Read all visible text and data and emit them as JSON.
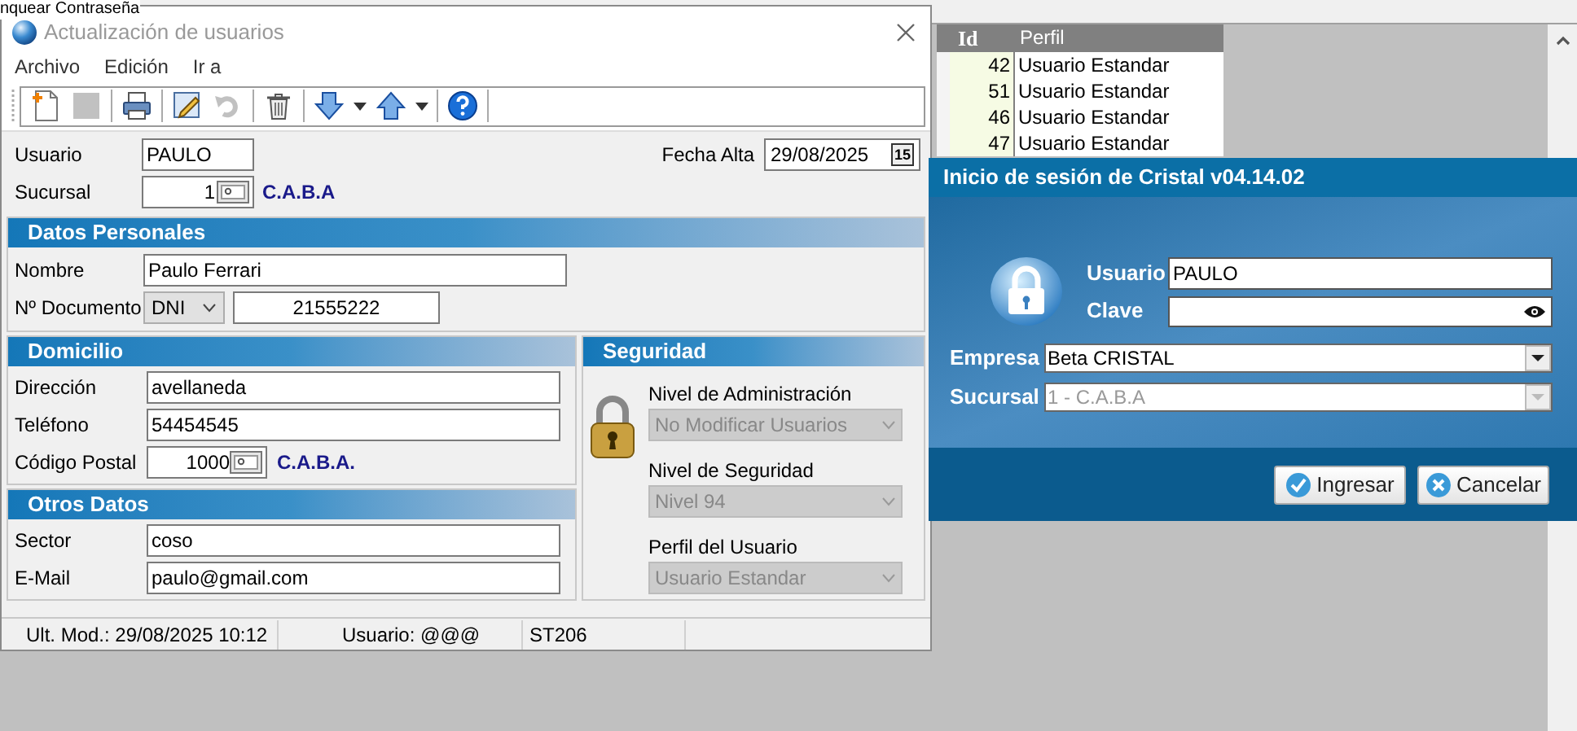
{
  "background_app": {
    "menu_item": "nquear Contraseña",
    "grid": {
      "columns": [
        "Id",
        "Perfil"
      ],
      "rows": [
        {
          "id": "42",
          "perfil": "Usuario Estandar"
        },
        {
          "id": "51",
          "perfil": "Usuario Estandar"
        },
        {
          "id": "46",
          "perfil": "Usuario Estandar"
        },
        {
          "id": "47",
          "perfil": "Usuario Estandar"
        }
      ]
    }
  },
  "edit_window": {
    "title": "Actualización de usuarios",
    "menu": [
      "Archivo",
      "Edición",
      "Ir a"
    ],
    "toolbar": [
      {
        "kind": "new",
        "disabled": false
      },
      {
        "kind": "save",
        "disabled": true
      },
      {
        "kind": "print",
        "disabled": false
      },
      {
        "kind": "edit",
        "disabled": false
      },
      {
        "kind": "undo",
        "disabled": true
      },
      {
        "kind": "delete",
        "disabled": false
      },
      {
        "kind": "next",
        "disabled": false
      },
      {
        "kind": "previous",
        "disabled": false
      },
      {
        "kind": "help",
        "disabled": false
      }
    ],
    "usuario": {
      "label": "Usuario",
      "value": "PAULO"
    },
    "fecha_alta": {
      "label": "Fecha Alta",
      "value": "29/08/2025",
      "calendar_day": "15"
    },
    "sucursal": {
      "label": "Sucursal",
      "value": "1",
      "lookup_text": "C.A.B.A"
    },
    "datos_personales": {
      "title": "Datos Personales",
      "nombre": {
        "label": "Nombre",
        "value": "Paulo Ferrari"
      },
      "documento": {
        "label": "Nº Documento",
        "type": "DNI",
        "number": "21555222"
      }
    },
    "domicilio": {
      "title": "Domicilio",
      "fields": [
        {
          "kind": "text",
          "label": "Dirección",
          "value": "avellaneda"
        },
        {
          "kind": "text",
          "label": "Teléfono",
          "value": "54454545"
        },
        {
          "kind": "lookup",
          "label": "Código Postal",
          "value": "1000",
          "lookup_text": "C.A.B.A."
        }
      ]
    },
    "otros_datos": {
      "title": "Otros Datos",
      "fields": [
        {
          "kind": "text",
          "label": "Sector",
          "value": "coso"
        },
        {
          "kind": "text",
          "label": "E-Mail",
          "value": "paulo@gmail.com"
        }
      ]
    },
    "seguridad": {
      "title": "Seguridad",
      "fields": [
        {
          "label": "Nivel de Administración",
          "value": "No Modificar Usuarios",
          "disabled": true
        },
        {
          "label": "Nivel de Seguridad",
          "value": "Nivel 94",
          "disabled": true
        },
        {
          "label": "Perfil del Usuario",
          "value": "Usuario Estandar",
          "disabled": true
        }
      ]
    },
    "status_bar": [
      "Ult. Mod.: 29/08/2025 10:12",
      "Usuario: @@@",
      "ST206"
    ]
  },
  "login_dialog": {
    "title": "Inicio de sesión de Cristal v04.14.02",
    "usuario": {
      "label": "Usuario",
      "value": "PAULO"
    },
    "clave": {
      "label": "Clave"
    },
    "empresa": {
      "label": "Empresa",
      "value": "Beta CRISTAL",
      "disabled": false
    },
    "sucursal": {
      "label": "Sucursal",
      "value": "1 - C.A.B.A",
      "disabled": true
    },
    "buttons": [
      {
        "kind": "ok",
        "label": "Ingresar"
      },
      {
        "kind": "cancel",
        "label": "Cancelar"
      }
    ]
  }
}
